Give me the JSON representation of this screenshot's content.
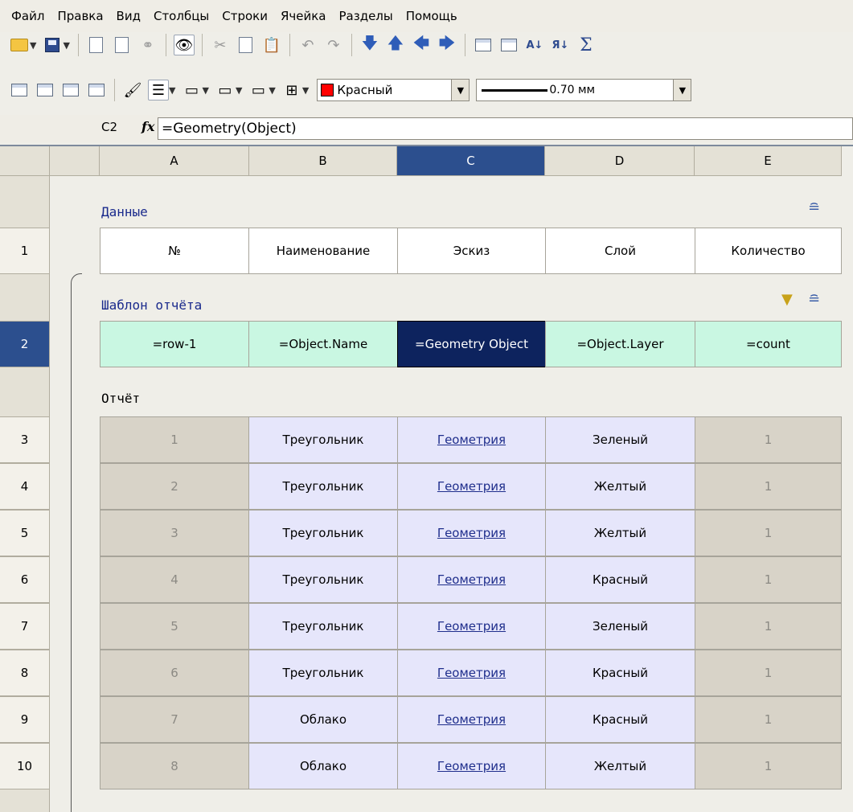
{
  "menu": [
    "Файл",
    "Правка",
    "Вид",
    "Столбцы",
    "Строки",
    "Ячейка",
    "Разделы",
    "Помощь"
  ],
  "toolbar": {
    "color_label": "Красный",
    "line_width_label": "0.70 мм",
    "sort_az": "А↓",
    "sort_za": "Я↓"
  },
  "formula_bar": {
    "cell_ref": "C2",
    "fx": "fx",
    "formula": "=Geometry(Object)"
  },
  "columns": [
    "A",
    "B",
    "C",
    "D",
    "E"
  ],
  "sections": {
    "data": "Данные",
    "template": "Шаблон отчёта",
    "report": "Отчёт"
  },
  "header_row": {
    "row_number": "1",
    "cells": [
      "№",
      "Наименование",
      "Эскиз",
      "Слой",
      "Количество"
    ]
  },
  "template_row": {
    "row_number": "2",
    "cells": [
      "=row-1",
      "=Object.Name",
      "=Geometry Object",
      "=Object.Layer",
      "=count"
    ]
  },
  "report_rows": [
    {
      "row_number": "3",
      "cells": [
        "1",
        "Треугольник",
        "Геометрия",
        "Зеленый",
        "1"
      ]
    },
    {
      "row_number": "4",
      "cells": [
        "2",
        "Треугольник",
        "Геометрия",
        "Желтый",
        "1"
      ]
    },
    {
      "row_number": "5",
      "cells": [
        "3",
        "Треугольник",
        "Геометрия",
        "Желтый",
        "1"
      ]
    },
    {
      "row_number": "6",
      "cells": [
        "4",
        "Треугольник",
        "Геометрия",
        "Красный",
        "1"
      ]
    },
    {
      "row_number": "7",
      "cells": [
        "5",
        "Треугольник",
        "Геометрия",
        "Зеленый",
        "1"
      ]
    },
    {
      "row_number": "8",
      "cells": [
        "6",
        "Треугольник",
        "Геометрия",
        "Красный",
        "1"
      ]
    },
    {
      "row_number": "9",
      "cells": [
        "7",
        "Облако",
        "Геометрия",
        "Красный",
        "1"
      ]
    },
    {
      "row_number": "10",
      "cells": [
        "8",
        "Облако",
        "Геометрия",
        "Желтый",
        "1"
      ]
    }
  ]
}
